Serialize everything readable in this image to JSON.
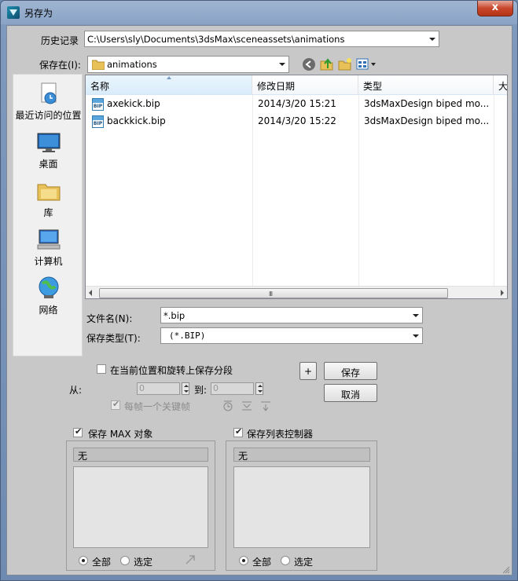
{
  "window": {
    "title": "另存为",
    "close_label": "x"
  },
  "history": {
    "label": "历史记录",
    "path": "C:\\Users\\sly\\Documents\\3dsMax\\sceneassets\\animations"
  },
  "save_in": {
    "label": "保存在(I):",
    "folder": "animations"
  },
  "places": [
    {
      "label": "最近访问的位置",
      "icon": "recent-places-icon"
    },
    {
      "label": "桌面",
      "icon": "desktop-icon"
    },
    {
      "label": "库",
      "icon": "libraries-icon"
    },
    {
      "label": "计算机",
      "icon": "computer-icon"
    },
    {
      "label": "网络",
      "icon": "network-icon"
    }
  ],
  "file_list": {
    "columns": [
      "名称",
      "修改日期",
      "类型",
      "大"
    ],
    "rows": [
      {
        "name": "axekick.bip",
        "date": "2014/3/20 15:21",
        "type": "3dsMaxDesign biped mo..."
      },
      {
        "name": "backkick.bip",
        "date": "2014/3/20 15:22",
        "type": "3dsMaxDesign biped mo..."
      }
    ],
    "scroll_grip": "III"
  },
  "filename": {
    "label": "文件名(N):",
    "value": "*.bip"
  },
  "filetype": {
    "label": "保存类型(T):",
    "value": "(*.BIP)"
  },
  "buttons": {
    "save": "保存",
    "cancel": "取消",
    "plus": "+"
  },
  "segment": {
    "checkbox_label": "在当前位置和旋转上保存分段",
    "from_label": "从:",
    "from_value": "0",
    "to_label": "到:",
    "to_value": "0",
    "per_frame_label": "每帧一个关键帧"
  },
  "max_objects": {
    "checkbox_label": "保存 MAX 对象",
    "list_header": "无",
    "radio_all": "全部",
    "radio_selected": "选定"
  },
  "list_controllers": {
    "checkbox_label": "保存列表控制器",
    "list_header": "无",
    "radio_all": "全部",
    "radio_selected": "选定"
  }
}
